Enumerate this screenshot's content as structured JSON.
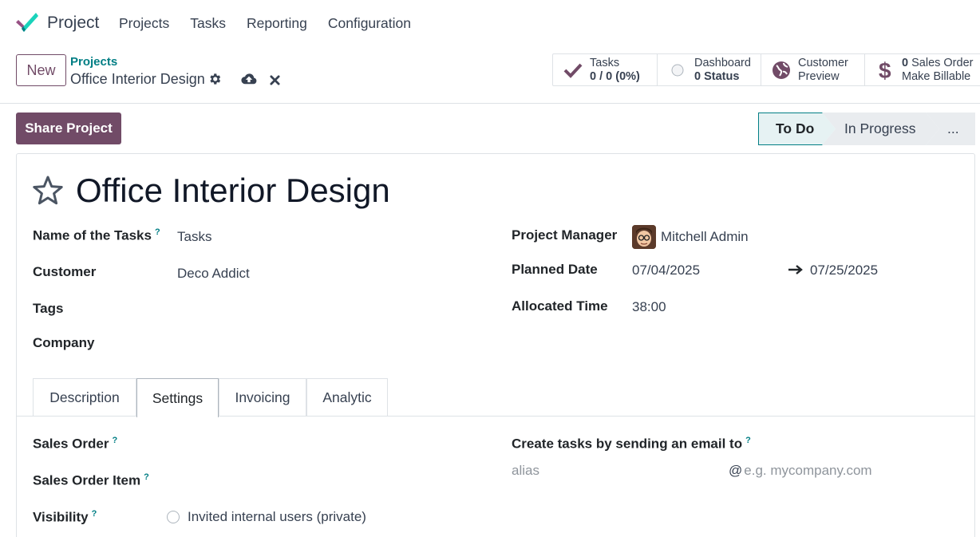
{
  "nav": {
    "app_name": "Project",
    "menu": [
      "Projects",
      "Tasks",
      "Reporting",
      "Configuration"
    ]
  },
  "control_panel": {
    "new_label": "New",
    "breadcrumb_parent": "Projects",
    "breadcrumb_current": "Office Interior Design",
    "stats": {
      "tasks_label": "Tasks",
      "tasks_value": "0 / 0 (0%)",
      "dashboard_label": "Dashboard",
      "dashboard_value": "0 Status",
      "customer_line1": "Customer",
      "customer_line2": "Preview",
      "sales_count": "0",
      "sales_line1_rest": " Sales Order",
      "sales_line2": "Make Billable"
    }
  },
  "actions": {
    "share_label": "Share Project"
  },
  "stages": {
    "current": "To Do",
    "next": "In Progress",
    "more": "..."
  },
  "form": {
    "title": "Office Interior Design",
    "left": {
      "name_tasks_label": "Name of the Tasks",
      "name_tasks_value": "Tasks",
      "customer_label": "Customer",
      "customer_value": "Deco Addict",
      "tags_label": "Tags",
      "company_label": "Company"
    },
    "right": {
      "manager_label": "Project Manager",
      "manager_value": "Mitchell Admin",
      "planned_label": "Planned Date",
      "planned_start": "07/04/2025",
      "planned_end": "07/25/2025",
      "allocated_label": "Allocated Time",
      "allocated_value": "38:00"
    },
    "help_mark": "?"
  },
  "tabs": [
    "Description",
    "Settings",
    "Invoicing",
    "Analytic"
  ],
  "active_tab": "Settings",
  "settings": {
    "sales_order_label": "Sales Order",
    "sales_order_item_label": "Sales Order Item",
    "visibility_label": "Visibility",
    "visibility_value": "Invited internal users (private)",
    "email_label": "Create tasks by sending an email to",
    "alias_placeholder": "alias",
    "at_sign": "@",
    "domain_placeholder": "e.g. mycompany.com"
  },
  "colors": {
    "brand": "#714b67",
    "accent": "#017e84"
  }
}
